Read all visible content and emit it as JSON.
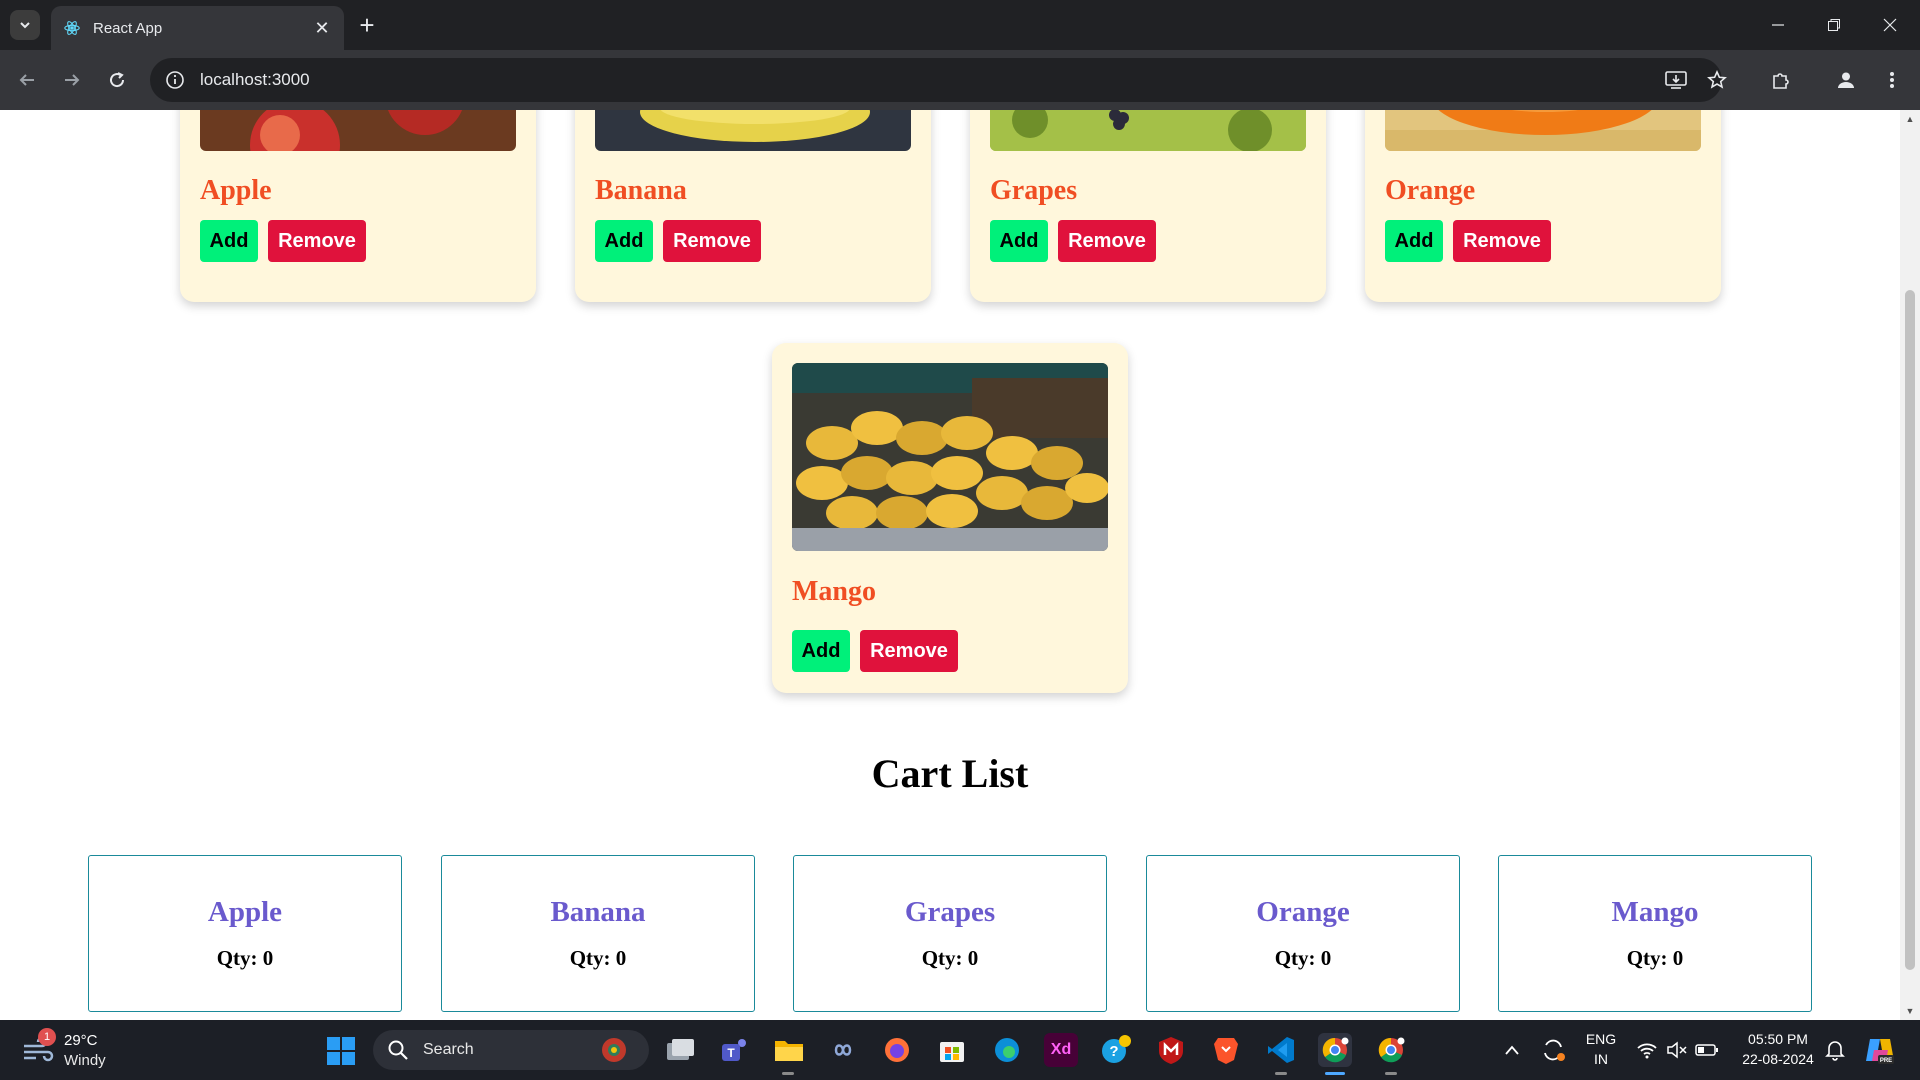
{
  "browser": {
    "tab_title": "React App",
    "url": "localhost:3000"
  },
  "products": [
    {
      "name": "Apple",
      "add_label": "Add",
      "remove_label": "Remove"
    },
    {
      "name": "Banana",
      "add_label": "Add",
      "remove_label": "Remove"
    },
    {
      "name": "Grapes",
      "add_label": "Add",
      "remove_label": "Remove"
    },
    {
      "name": "Orange",
      "add_label": "Add",
      "remove_label": "Remove"
    },
    {
      "name": "Mango",
      "add_label": "Add",
      "remove_label": "Remove"
    }
  ],
  "cart": {
    "title": "Cart List",
    "items": [
      {
        "name": "Apple",
        "qty": "Qty: 0"
      },
      {
        "name": "Banana",
        "qty": "Qty: 0"
      },
      {
        "name": "Grapes",
        "qty": "Qty: 0"
      },
      {
        "name": "Orange",
        "qty": "Qty: 0"
      },
      {
        "name": "Mango",
        "qty": "Qty: 0"
      }
    ]
  },
  "taskbar": {
    "weather_badge": "1",
    "weather_temp": "29°C",
    "weather_condition": "Windy",
    "search_label": "Search",
    "xd_label": "Xd",
    "language": "ENG",
    "region": "IN",
    "time": "05:50 PM",
    "date": "22-08-2024"
  },
  "colors": {
    "card_background": "#fff7dc",
    "product_name": "#f04e23",
    "add_button": "#00f07a",
    "remove_button": "#e0123c",
    "cart_name": "#6a5acd",
    "cart_border": "#1a8a9a"
  }
}
